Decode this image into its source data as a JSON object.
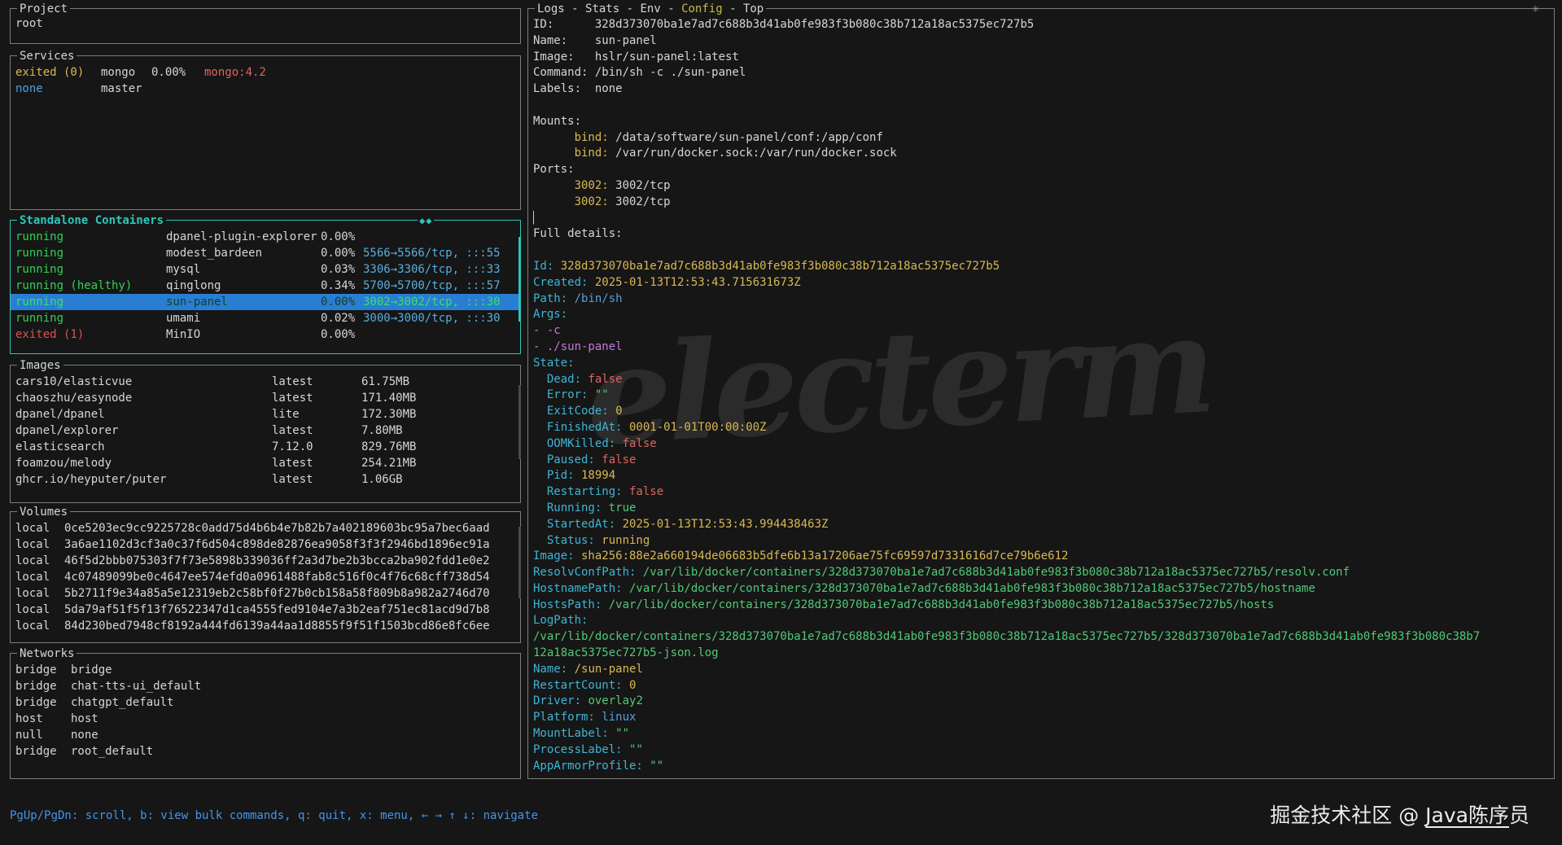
{
  "colors": {
    "background": "#161616",
    "border_inactive": "#7d7d7d",
    "border_active": "#2fc5bb",
    "selection_blue": "#2a7ed2",
    "running_green": "#33d054",
    "exited_red": "#e0514c",
    "key_cyan": "#3fb5d4",
    "value_yellow": "#d8b855",
    "string_green": "#53c878",
    "statusbar_blue": "#4794e8"
  },
  "window": {
    "icon": "✳"
  },
  "watermark": "electerm",
  "project": {
    "title": "Project",
    "name": "root"
  },
  "services": {
    "title": "Services",
    "rows": [
      {
        "status": "exited (0)",
        "state": "exited0",
        "name": "mongo",
        "cpu": "0.00%",
        "image": "mongo:4.2"
      },
      {
        "status": "none",
        "state": "none",
        "name": "master",
        "cpu": "",
        "image": ""
      }
    ]
  },
  "containers": {
    "title": "Standalone Containers",
    "corner_marks": "◆◆",
    "rows": [
      {
        "status": "running",
        "state": "running",
        "name": "dpanel-plugin-explorer",
        "cpu": "0.00%",
        "ports": "",
        "selected": false
      },
      {
        "status": "running",
        "state": "running",
        "name": "modest_bardeen",
        "cpu": "0.00%",
        "ports": "5566→5566/tcp, :::55",
        "selected": false
      },
      {
        "status": "running",
        "state": "running",
        "name": "mysql",
        "cpu": "0.03%",
        "ports": "3306→3306/tcp, :::33",
        "selected": false
      },
      {
        "status": "running (healthy)",
        "state": "running",
        "name": "qinglong",
        "cpu": "0.34%",
        "ports": "5700→5700/tcp, :::57",
        "selected": false
      },
      {
        "status": "running",
        "state": "running",
        "name": "sun-panel",
        "cpu": "0.00%",
        "ports": "3002→3002/tcp, :::30",
        "selected": true
      },
      {
        "status": "running",
        "state": "running",
        "name": "umami",
        "cpu": "0.02%",
        "ports": "3000→3000/tcp, :::30",
        "selected": false
      },
      {
        "status": "exited (1)",
        "state": "exited",
        "name": "MinIO",
        "cpu": "0.00%",
        "ports": "",
        "selected": false
      }
    ]
  },
  "images": {
    "title": "Images",
    "rows": [
      {
        "name": "cars10/elasticvue",
        "tag": "latest",
        "size": "61.75MB"
      },
      {
        "name": "chaoszhu/easynode",
        "tag": "latest",
        "size": "171.40MB"
      },
      {
        "name": "dpanel/dpanel",
        "tag": "lite",
        "size": "172.30MB"
      },
      {
        "name": "dpanel/explorer",
        "tag": "latest",
        "size": "7.80MB"
      },
      {
        "name": "elasticsearch",
        "tag": "7.12.0",
        "size": "829.76MB"
      },
      {
        "name": "foamzou/melody",
        "tag": "latest",
        "size": "254.21MB"
      },
      {
        "name": "ghcr.io/heyputer/puter",
        "tag": "latest",
        "size": "1.06GB"
      }
    ]
  },
  "volumes": {
    "title": "Volumes",
    "rows": [
      {
        "driver": "local",
        "id": "0ce5203ec9cc9225728c0add75d4b6b4e7b82b7a402189603bc95a7bec6aad"
      },
      {
        "driver": "local",
        "id": "3a6ae1102d3cf3a0c37f6d504c898de82876ea9058f3f3f2946bd1896ec91a"
      },
      {
        "driver": "local",
        "id": "46f5d2bbb075303f7f73e5898b339036ff2a3d7be2b3bcca2ba902fdd1e0e2"
      },
      {
        "driver": "local",
        "id": "4c07489099be0c4647ee574efd0a0961488fab8c516f0c4f76c68cff738d54"
      },
      {
        "driver": "local",
        "id": "5b2711f9e34a85a5e12319eb2c58bf0f27b0cb158a58f809b8a982a2746d70"
      },
      {
        "driver": "local",
        "id": "5da79af51f5f13f76522347d1ca4555fed9104e7a3b2eaf751ec81acd9d7b8"
      },
      {
        "driver": "local",
        "id": "84d230bed7948cf8192a444fd6139a44aa1d8855f9f51f1503bcd86e8fc6ee"
      }
    ]
  },
  "networks": {
    "title": "Networks",
    "rows": [
      {
        "driver": "bridge",
        "name": "bridge"
      },
      {
        "driver": "bridge",
        "name": "chat-tts-ui_default"
      },
      {
        "driver": "bridge",
        "name": "chatgpt_default"
      },
      {
        "driver": "host",
        "name": "host"
      },
      {
        "driver": "null",
        "name": "none"
      },
      {
        "driver": "bridge",
        "name": "root_default"
      }
    ]
  },
  "detail": {
    "tabs": [
      "Logs",
      "Stats",
      "Env",
      "Config",
      "Top"
    ],
    "active_tab": "Config",
    "lines": [
      [
        [
          "w",
          "ID:      328d373070ba1e7ad7c688b3d41ab0fe983f3b080c38b712a18ac5375ec727b5"
        ]
      ],
      [
        [
          "w",
          "Name:    sun-panel"
        ]
      ],
      [
        [
          "w",
          "Image:   hslr/sun-panel:latest"
        ]
      ],
      [
        [
          "w",
          "Command: /bin/sh -c ./sun-panel"
        ]
      ],
      [
        [
          "w",
          "Labels:  none"
        ]
      ],
      [],
      [
        [
          "w",
          "Mounts: "
        ]
      ],
      [
        [
          "y",
          "      bind:"
        ],
        [
          "w",
          " /data/software/sun-panel/conf:/app/conf"
        ]
      ],
      [
        [
          "y",
          "      bind:"
        ],
        [
          "w",
          " /var/run/docker.sock:/var/run/docker.sock"
        ]
      ],
      [
        [
          "w",
          "Ports: "
        ]
      ],
      [
        [
          "y",
          "      3002:"
        ],
        [
          "w",
          " 3002/tcp"
        ]
      ],
      [
        [
          "y",
          "      3002:"
        ],
        [
          "w",
          " 3002/tcp"
        ]
      ],
      [
        [
          "w",
          "▏"
        ]
      ],
      [
        [
          "w",
          "Full details:"
        ]
      ],
      [],
      [
        [
          "k",
          "Id:"
        ],
        [
          "y",
          " 328d373070ba1e7ad7c688b3d41ab0fe983f3b080c38b712a18ac5375ec727b5"
        ]
      ],
      [
        [
          "k",
          "Created:"
        ],
        [
          "y",
          " 2025-01-13T12:53:43.715631673Z"
        ]
      ],
      [
        [
          "k",
          "Path:"
        ],
        [
          "b",
          " /bin/sh"
        ]
      ],
      [
        [
          "k",
          "Args:"
        ]
      ],
      [
        [
          "m",
          "- -c"
        ]
      ],
      [
        [
          "m",
          "- ./sun-panel"
        ]
      ],
      [
        [
          "k",
          "State:"
        ]
      ],
      [
        [
          "k",
          "  Dead:"
        ],
        [
          "r",
          " false"
        ]
      ],
      [
        [
          "k",
          "  Error:"
        ],
        [
          "g",
          " \"\""
        ]
      ],
      [
        [
          "k",
          "  ExitCode:"
        ],
        [
          "y",
          " 0"
        ]
      ],
      [
        [
          "k",
          "  FinishedAt:"
        ],
        [
          "y",
          " 0001-01-01T00:00:00Z"
        ]
      ],
      [
        [
          "k",
          "  OOMKilled:"
        ],
        [
          "r",
          " false"
        ]
      ],
      [
        [
          "k",
          "  Paused:"
        ],
        [
          "r",
          " false"
        ]
      ],
      [
        [
          "k",
          "  Pid:"
        ],
        [
          "y",
          " 18994"
        ]
      ],
      [
        [
          "k",
          "  Restarting:"
        ],
        [
          "r",
          " false"
        ]
      ],
      [
        [
          "k",
          "  Running:"
        ],
        [
          "g",
          " true"
        ]
      ],
      [
        [
          "k",
          "  StartedAt:"
        ],
        [
          "y",
          " 2025-01-13T12:53:43.994438463Z"
        ]
      ],
      [
        [
          "k",
          "  Status:"
        ],
        [
          "y",
          " running"
        ]
      ],
      [
        [
          "k",
          "Image:"
        ],
        [
          "y",
          " sha256:88e2a660194de06683b5dfe6b13a17206ae75fc69597d7331616d7ce79b6e612"
        ]
      ],
      [
        [
          "k",
          "ResolvConfPath:"
        ],
        [
          "g",
          " /var/lib/docker/containers/328d373070ba1e7ad7c688b3d41ab0fe983f3b080c38b712a18ac5375ec727b5/resolv.conf"
        ]
      ],
      [
        [
          "k",
          "HostnamePath:"
        ],
        [
          "g",
          " /var/lib/docker/containers/328d373070ba1e7ad7c688b3d41ab0fe983f3b080c38b712a18ac5375ec727b5/hostname"
        ]
      ],
      [
        [
          "k",
          "HostsPath:"
        ],
        [
          "g",
          " /var/lib/docker/containers/328d373070ba1e7ad7c688b3d41ab0fe983f3b080c38b712a18ac5375ec727b5/hosts"
        ]
      ],
      [
        [
          "k",
          "LogPath:"
        ]
      ],
      [
        [
          "g",
          "/var/lib/docker/containers/328d373070ba1e7ad7c688b3d41ab0fe983f3b080c38b712a18ac5375ec727b5/328d373070ba1e7ad7c688b3d41ab0fe983f3b080c38b7"
        ]
      ],
      [
        [
          "g",
          "12a18ac5375ec727b5-json.log"
        ]
      ],
      [
        [
          "k",
          "Name:"
        ],
        [
          "y",
          " /sun-panel"
        ]
      ],
      [
        [
          "k",
          "RestartCount:"
        ],
        [
          "y",
          " 0"
        ]
      ],
      [
        [
          "k",
          "Driver:"
        ],
        [
          "g",
          " overlay2"
        ]
      ],
      [
        [
          "k",
          "Platform:"
        ],
        [
          "b",
          " linux"
        ]
      ],
      [
        [
          "k",
          "MountLabel:"
        ],
        [
          "g",
          " \"\""
        ]
      ],
      [
        [
          "k",
          "ProcessLabel:"
        ],
        [
          "g",
          " \"\""
        ]
      ],
      [
        [
          "k",
          "AppArmorProfile:"
        ],
        [
          "g",
          " \"\""
        ]
      ]
    ]
  },
  "statusbar": {
    "text": "PgUp/PgDn: scroll, b: view bulk commands, q: quit, x: menu, ← → ↑ ↓: navigate"
  },
  "credit": {
    "part1": "掘金技术社区 @ ",
    "part2": "Java陈序",
    "part3": "员"
  }
}
